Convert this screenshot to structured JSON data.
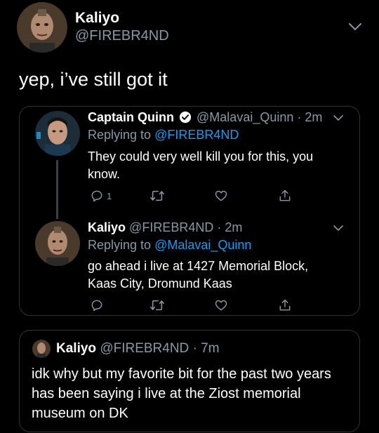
{
  "main_tweet": {
    "display_name": "Kaliyo",
    "handle": "@FIREBR4ND",
    "text": "yep, i’ve still got it"
  },
  "quoted_thread": {
    "reply1": {
      "display_name": "Captain Quinn",
      "handle": "@Malavai_Quinn",
      "time": "· 2m",
      "replying_prefix": "Replying to",
      "replying_to": "@FIREBR4ND",
      "text": "They could very well kill you for this, you know.",
      "reply_count": "1"
    },
    "reply2": {
      "display_name": "Kaliyo",
      "handle": "@FIREBR4ND",
      "time": "· 2m",
      "replying_prefix": "Replying to",
      "replying_to": "@Malavai_Quinn",
      "text": "go ahead i live at 1427 Memorial Block, Kaas City, Dromund Kaas"
    }
  },
  "quote_tweet": {
    "display_name": "Kaliyo",
    "handle": "@FIREBR4ND",
    "time": "· 7m",
    "text": "idk why but my favorite bit for the past two years has been saying i live at the Ziost memorial museum on DK"
  },
  "colors": {
    "background": "#000000",
    "text": "#ffffff",
    "secondary": "#8899a6",
    "link": "#1d9bf0",
    "border": "#2f3336"
  },
  "icons": [
    "chevron-down-icon",
    "verified-badge-icon",
    "reply-icon",
    "retweet-icon",
    "like-icon",
    "share-icon"
  ]
}
